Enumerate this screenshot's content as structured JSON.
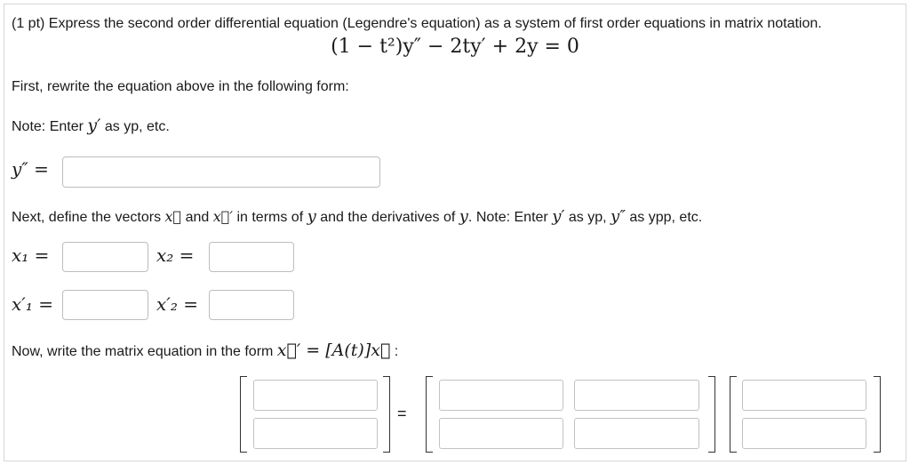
{
  "problem": {
    "intro": "(1 pt) Express the second order differential equation (Legendre's equation) as a system of first order equations in matrix notation.",
    "equation": "(1 − t²)y″ − 2ty′ + 2y = 0"
  },
  "step1": {
    "instruction": "First, rewrite the equation above in the following form:",
    "note_prefix": "Note: Enter ",
    "note_symbol": "y′",
    "note_suffix": " as yp, etc.",
    "label": "y″ =",
    "input_value": ""
  },
  "step2": {
    "text_a": "Next, define the vectors ",
    "vec": "x⃗",
    "text_b": " and ",
    "vecp": "x⃗′",
    "text_c": " in terms of ",
    "y1": "y",
    "text_d": " and the derivatives of ",
    "y2": "y",
    "text_e": ". Note: Enter ",
    "yp": "y′",
    "text_f": " as yp, ",
    "ypp": "y″",
    "text_g": " as ypp, etc.",
    "labels": {
      "x1": "x₁ =",
      "x2": "x₂ =",
      "x1p": "x′₁ =",
      "x2p": "x′₂ ="
    }
  },
  "step3": {
    "text_a": "Now, write the matrix equation in the form ",
    "formula": "x⃗′ = [A(t)]x⃗",
    "text_b": " :",
    "equals": "="
  }
}
